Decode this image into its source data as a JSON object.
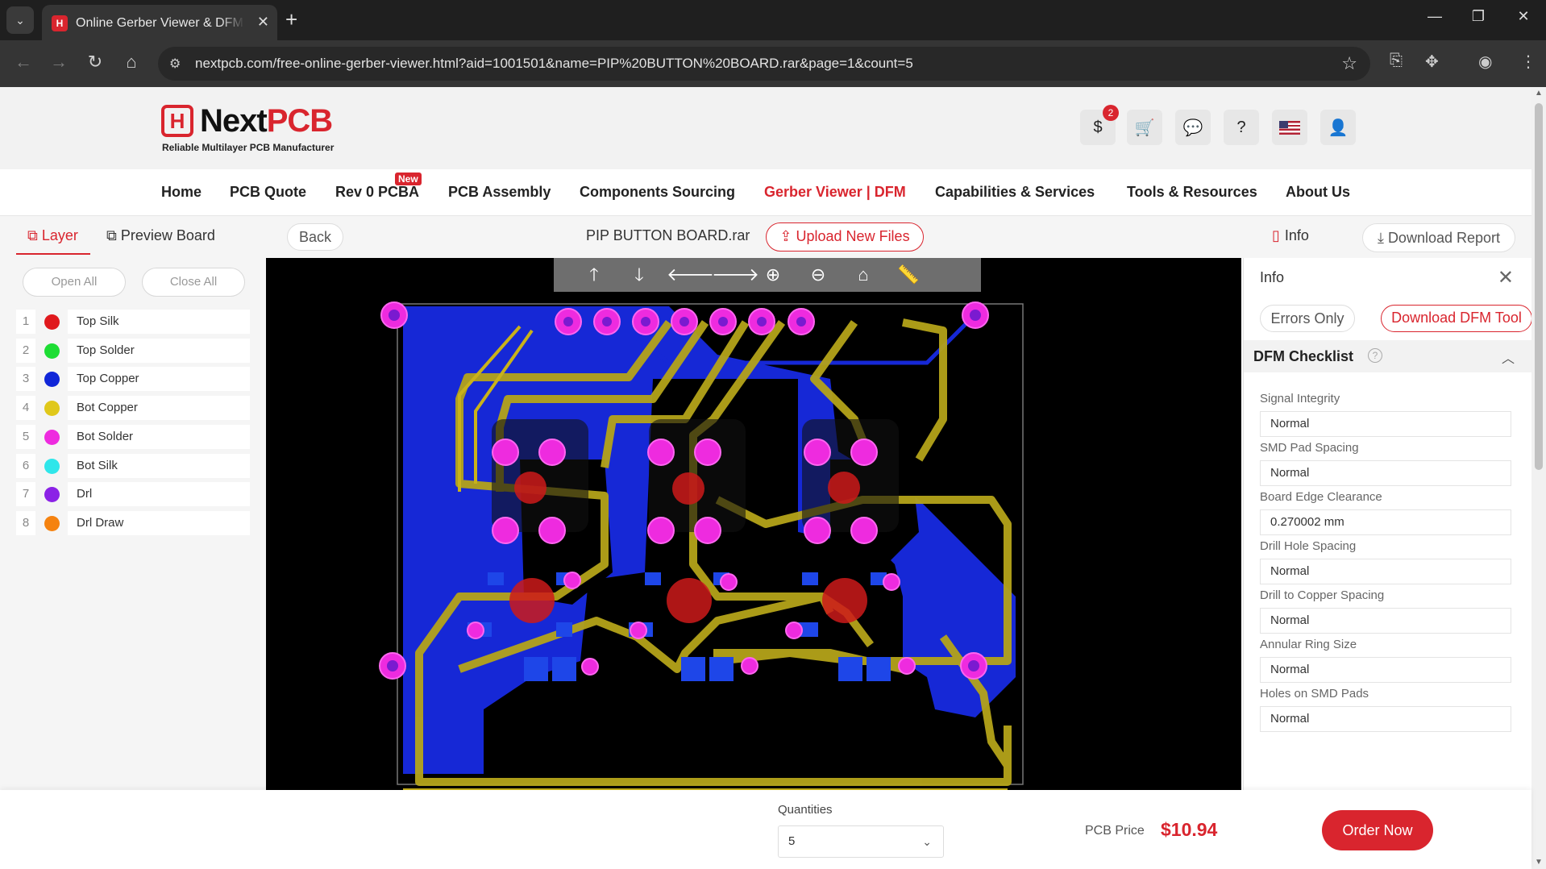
{
  "browser": {
    "tab_title": "Online Gerber Viewer & DFM Analysis",
    "url": "nextpcb.com/free-online-gerber-viewer.html?aid=1001501&name=PIP%20BUTTON%20BOARD.rar&page=1&count=5"
  },
  "header": {
    "logo_brand_a": "Next",
    "logo_brand_b": "PCB",
    "logo_mark": "H",
    "logo_tagline": "Reliable Multilayer PCB Manufacturer",
    "coupon_badge": "2",
    "icons": [
      "coupon-icon",
      "cart-icon",
      "message-icon",
      "help-icon",
      "us-flag-icon",
      "user-icon"
    ]
  },
  "nav": {
    "items": [
      "Home",
      "PCB Quote",
      "Rev 0 PCBA",
      "PCB Assembly",
      "Components Sourcing",
      "Gerber Viewer | DFM",
      "Capabilities & Services",
      "Tools & Resources",
      "About Us"
    ],
    "new_badge": "New",
    "active": "Gerber Viewer | DFM"
  },
  "viewer": {
    "tab_layer": "Layer",
    "tab_preview": "Preview Board",
    "back": "Back",
    "file_name": "PIP BUTTON BOARD.rar",
    "upload": "Upload New Files",
    "info": "Info",
    "download_report": "Download Report"
  },
  "layers": {
    "open_all": "Open All",
    "close_all": "Close All",
    "items": [
      {
        "num": "1",
        "name": "Top Silk",
        "color": "#e0191d"
      },
      {
        "num": "2",
        "name": "Top Solder",
        "color": "#1ddd34"
      },
      {
        "num": "3",
        "name": "Top Copper",
        "color": "#1026d8"
      },
      {
        "num": "4",
        "name": "Bot Copper",
        "color": "#e0c81a"
      },
      {
        "num": "5",
        "name": "Bot Solder",
        "color": "#ee2bdf"
      },
      {
        "num": "6",
        "name": "Bot Silk",
        "color": "#2fe6ea"
      },
      {
        "num": "7",
        "name": "Drl",
        "color": "#8b22e6"
      },
      {
        "num": "8",
        "name": "Drl Draw",
        "color": "#f5820f"
      }
    ]
  },
  "info_panel": {
    "title": "Info",
    "errors_only": "Errors Only",
    "download_dfm": "Download DFM Tool",
    "checklist_title": "DFM Checklist",
    "checks": [
      {
        "label": "Signal Integrity",
        "value": "Normal"
      },
      {
        "label": "SMD Pad Spacing",
        "value": "Normal"
      },
      {
        "label": "Board Edge Clearance",
        "value": "0.270002 mm"
      },
      {
        "label": "Drill Hole Spacing",
        "value": "Normal"
      },
      {
        "label": "Drill to Copper Spacing",
        "value": "Normal"
      },
      {
        "label": "Annular Ring Size",
        "value": "Normal"
      },
      {
        "label": "Holes on SMD Pads",
        "value": "Normal"
      }
    ]
  },
  "order": {
    "quantities_label": "Quantities",
    "quantity": "5",
    "price_label": "PCB Price",
    "price": "$10.94",
    "order_button": "Order Now"
  }
}
